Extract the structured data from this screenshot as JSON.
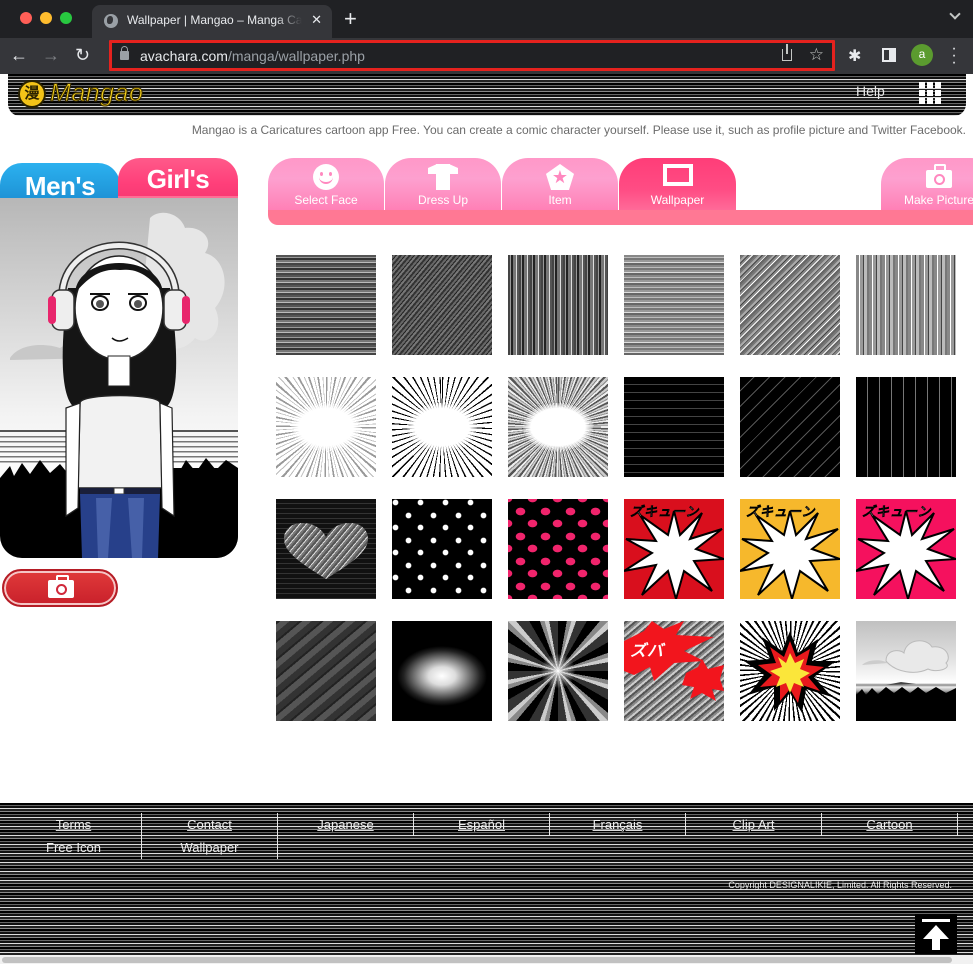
{
  "browser": {
    "tab_title": "Wallpaper | Mangao – Manga Caricatures",
    "tab_close": "✕",
    "new_tab": "+",
    "url_domain": "avachara.com",
    "url_path": "/manga/wallpaper.php",
    "profile_initial": "a",
    "icons": [
      "back-icon",
      "forward-icon",
      "reload-icon",
      "lock-icon",
      "share-icon",
      "bookmark-star-icon",
      "extensions-icon",
      "side-panel-icon",
      "more-menu-icon"
    ]
  },
  "header": {
    "logo_badge": "漫",
    "logo_text": "Mangao",
    "help": "Help",
    "tagline": "Mangao is a Caricatures cartoon app Free. You can create a comic character yourself. Please use it, such as profile picture and Twitter Facebook."
  },
  "gender_tabs": {
    "men": "Men's",
    "girls": "Girl's",
    "active": "girls"
  },
  "category_tabs": [
    {
      "label": "Select Face",
      "icon": "smile-icon"
    },
    {
      "label": "Dress Up",
      "icon": "tshirt-icon"
    },
    {
      "label": "Item",
      "icon": "pentagon-star-icon"
    },
    {
      "label": "Wallpaper",
      "icon": "frame-icon",
      "active": true
    },
    {
      "label": "Make Picture",
      "icon": "camera-icon"
    }
  ],
  "wallpapers": {
    "spike_text": "ズキューン",
    "zubi_text": "ズバ",
    "items": [
      "horizontal-stripes-dark",
      "diagonal-stripes-dark",
      "vertical-stripes-dark",
      "horizontal-stripes-light",
      "diagonal-stripes-light",
      "vertical-stripes-light",
      "speed-lines-gray",
      "speed-lines-black",
      "speed-lines-soft",
      "black-horizontal-lines",
      "black-diagonal-lines",
      "black-vertical-lines",
      "striped-heart",
      "skull-pattern",
      "pink-hearts-pattern",
      "burst-red",
      "burst-yellow",
      "burst-pink",
      "dark-diagonal-bands",
      "radial-glow",
      "light-rays",
      "zubi-red-splash",
      "explosion",
      "cloud-landscape"
    ]
  },
  "footer": {
    "links": [
      "Terms",
      "Contact",
      "Japanese",
      "Español",
      "Français",
      "Clip Art",
      "Cartoon",
      "Free Icon",
      "Wallpaper"
    ],
    "copyright": "Copyright DESIGNALIKIE, Limited. All Rights Reserved."
  }
}
